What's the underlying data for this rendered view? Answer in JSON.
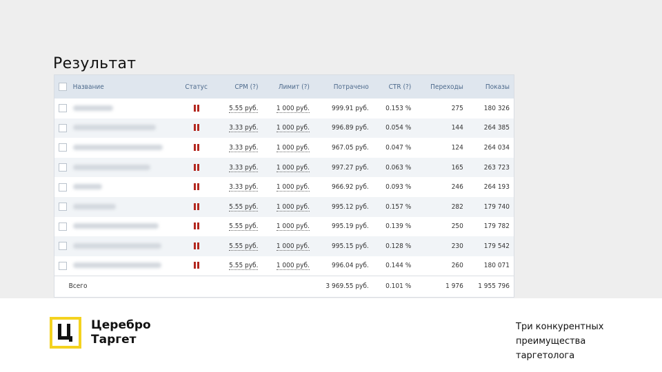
{
  "slide": {
    "title": "Результат",
    "tagline": [
      "Три конкурентных",
      "преимущества",
      "таргетолога"
    ]
  },
  "logo": {
    "line1": "Церебро",
    "line2": "Таргет",
    "accent": "#f4d21f"
  },
  "table": {
    "headers": {
      "name": "Название",
      "status": "Статус",
      "cpm": "CPM (?)",
      "limit": "Лимит (?)",
      "spent": "Потрачено",
      "ctr": "CTR (?)",
      "clicks": "Переходы",
      "impressions": "Показы"
    },
    "rows": [
      {
        "cpm": "5.55 руб.",
        "limit": "1 000 руб.",
        "spent": "999.91 руб.",
        "ctr": "0.153 %",
        "clicks": "275",
        "impressions": "180 326"
      },
      {
        "cpm": "3.33 руб.",
        "limit": "1 000 руб.",
        "spent": "996.89 руб.",
        "ctr": "0.054 %",
        "clicks": "144",
        "impressions": "264 385"
      },
      {
        "cpm": "3.33 руб.",
        "limit": "1 000 руб.",
        "spent": "967.05 руб.",
        "ctr": "0.047 %",
        "clicks": "124",
        "impressions": "264 034"
      },
      {
        "cpm": "3.33 руб.",
        "limit": "1 000 руб.",
        "spent": "997.27 руб.",
        "ctr": "0.063 %",
        "clicks": "165",
        "impressions": "263 723"
      },
      {
        "cpm": "3.33 руб.",
        "limit": "1 000 руб.",
        "spent": "966.92 руб.",
        "ctr": "0.093 %",
        "clicks": "246",
        "impressions": "264 193"
      },
      {
        "cpm": "5.55 руб.",
        "limit": "1 000 руб.",
        "spent": "995.12 руб.",
        "ctr": "0.157 %",
        "clicks": "282",
        "impressions": "179 740"
      },
      {
        "cpm": "5.55 руб.",
        "limit": "1 000 руб.",
        "spent": "995.19 руб.",
        "ctr": "0.139 %",
        "clicks": "250",
        "impressions": "179 782"
      },
      {
        "cpm": "5.55 руб.",
        "limit": "1 000 руб.",
        "spent": "995.15 руб.",
        "ctr": "0.128 %",
        "clicks": "230",
        "impressions": "179 542"
      },
      {
        "cpm": "5.55 руб.",
        "limit": "1 000 руб.",
        "spent": "996.04 руб.",
        "ctr": "0.144 %",
        "clicks": "260",
        "impressions": "180 071"
      }
    ],
    "footer": {
      "label": "Всего",
      "spent": "3 969.55 руб.",
      "ctr": "0.101 %",
      "clicks": "1 976",
      "impressions": "1 955 796"
    },
    "status_icon": "pause-icon",
    "status_color": "#b3271f"
  }
}
